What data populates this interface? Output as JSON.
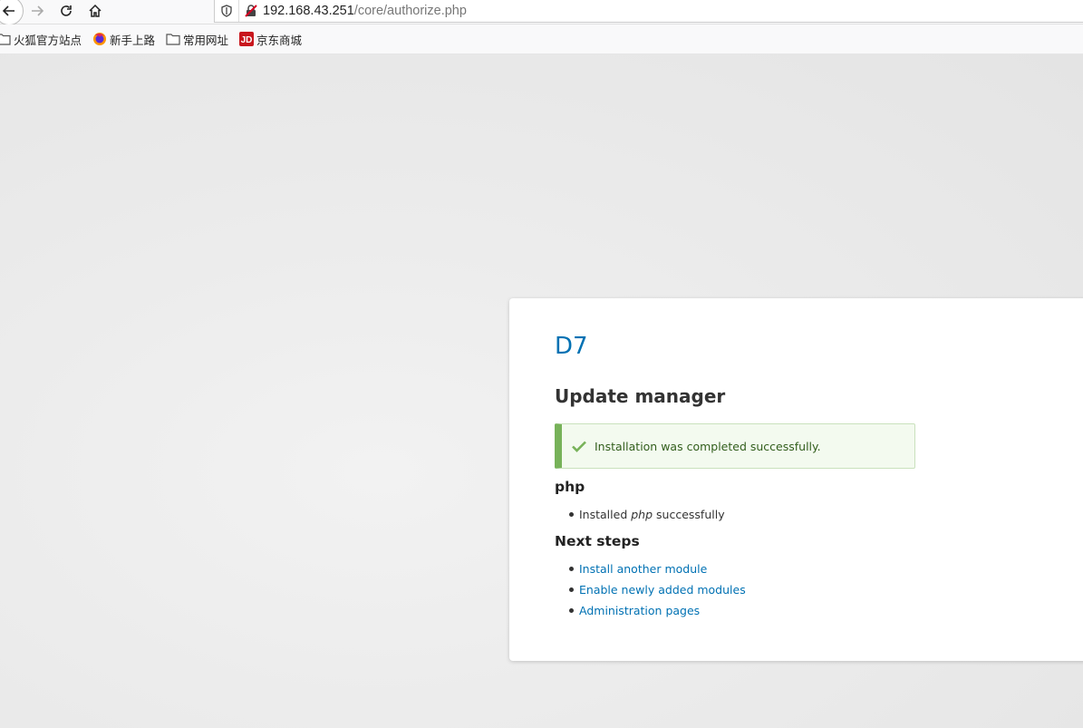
{
  "browser": {
    "url_host": "192.168.43.251",
    "url_path": "/core/authorize.php",
    "bookmarks": [
      {
        "label": "火狐官方站点",
        "icon": "folder-icon"
      },
      {
        "label": "新手上路",
        "icon": "firefox-icon"
      },
      {
        "label": "常用网址",
        "icon": "folder-icon"
      },
      {
        "label": "京东商城",
        "icon": "jd-icon",
        "icon_text": "JD"
      }
    ]
  },
  "page": {
    "site_name": "D7",
    "title": "Update manager",
    "status_message": "Installation was completed successfully.",
    "project_heading": "php",
    "installed_prefix": "Installed",
    "installed_project": "php",
    "installed_suffix": "successfully",
    "next_steps_heading": "Next steps",
    "next_steps": [
      "Install another module",
      "Enable newly added modules",
      "Administration pages"
    ]
  },
  "colors": {
    "link": "#0071b3",
    "status_border": "#77b259",
    "status_bg": "#f3faef"
  }
}
